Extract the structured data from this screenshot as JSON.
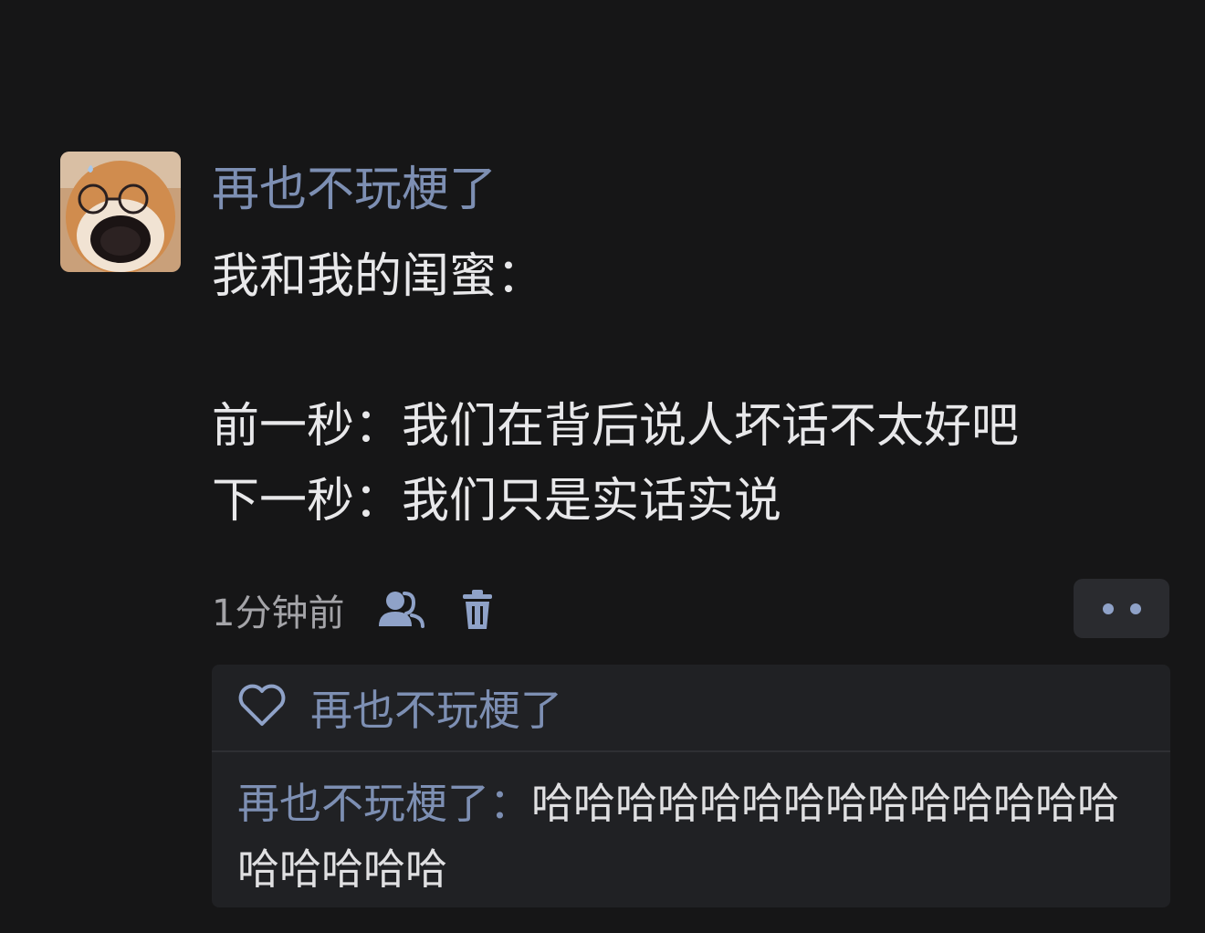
{
  "post": {
    "username": "再也不玩梗了",
    "lines": [
      "我和我的闺蜜：",
      "",
      "前一秒：我们在背后说人坏话不太好吧",
      "下一秒：我们只是实话实说"
    ],
    "timestamp": "1分钟前"
  },
  "icons": {
    "friends": "friends-visibility-icon",
    "delete": "trash-icon",
    "more": "more-dots-icon",
    "like": "heart-outline-icon"
  },
  "comments_box": {
    "liked_by": "再也不玩梗了",
    "comment": {
      "author": "再也不玩梗了",
      "separator": "：",
      "text": "哈哈哈哈哈哈哈哈哈哈哈哈哈哈哈哈哈哈哈"
    }
  },
  "colors": {
    "background": "#161617",
    "name_link": "#7d8fb3",
    "panel": "#202124",
    "icon": "#8fa2c8"
  }
}
